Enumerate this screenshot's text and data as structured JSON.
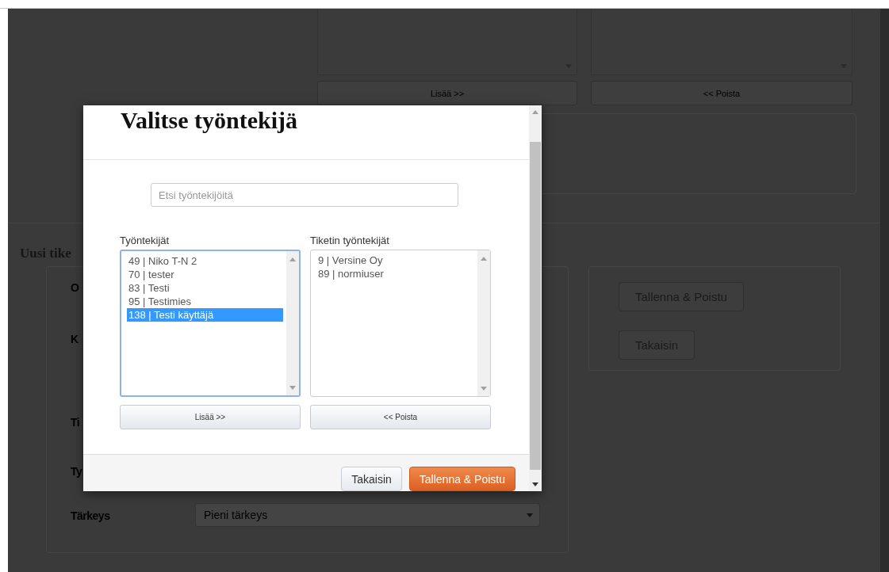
{
  "page": {
    "top_buttons": [
      "Lisää >>",
      "<< Poista"
    ],
    "heading": "Uusi tike",
    "form_labels": [
      "O",
      "K",
      "Ti",
      "Ty"
    ],
    "priority": {
      "label": "Tärkeys",
      "value": "Pieni tärkeys"
    },
    "side_buttons": [
      "Tallenna & Poistu",
      "Takaisin"
    ]
  },
  "dialog": {
    "title": "Valitse työntekijä",
    "search": {
      "placeholder": "Etsi työntekijöitä"
    },
    "lists": [
      {
        "label": "Työntekijät",
        "focused": true,
        "items": [
          {
            "text": "49 | Niko T-N 2",
            "selected": false
          },
          {
            "text": "70 | tester",
            "selected": false
          },
          {
            "text": "83 | Testi",
            "selected": false
          },
          {
            "text": "95 | Testimies",
            "selected": false
          },
          {
            "text": "138 | Testi käyttäjä",
            "selected": true
          }
        ]
      },
      {
        "label": "Tiketin työntekijät",
        "focused": false,
        "items": [
          {
            "text": "9 | Versine Oy",
            "selected": false
          },
          {
            "text": "89 | normiuser",
            "selected": false
          }
        ]
      }
    ],
    "list_buttons": [
      "Lisää >>",
      "<< Poista"
    ],
    "footer_buttons": [
      {
        "label": "Takaisin",
        "kind": "default"
      },
      {
        "label": "Tallenna & Poistu",
        "kind": "primary"
      }
    ]
  }
}
